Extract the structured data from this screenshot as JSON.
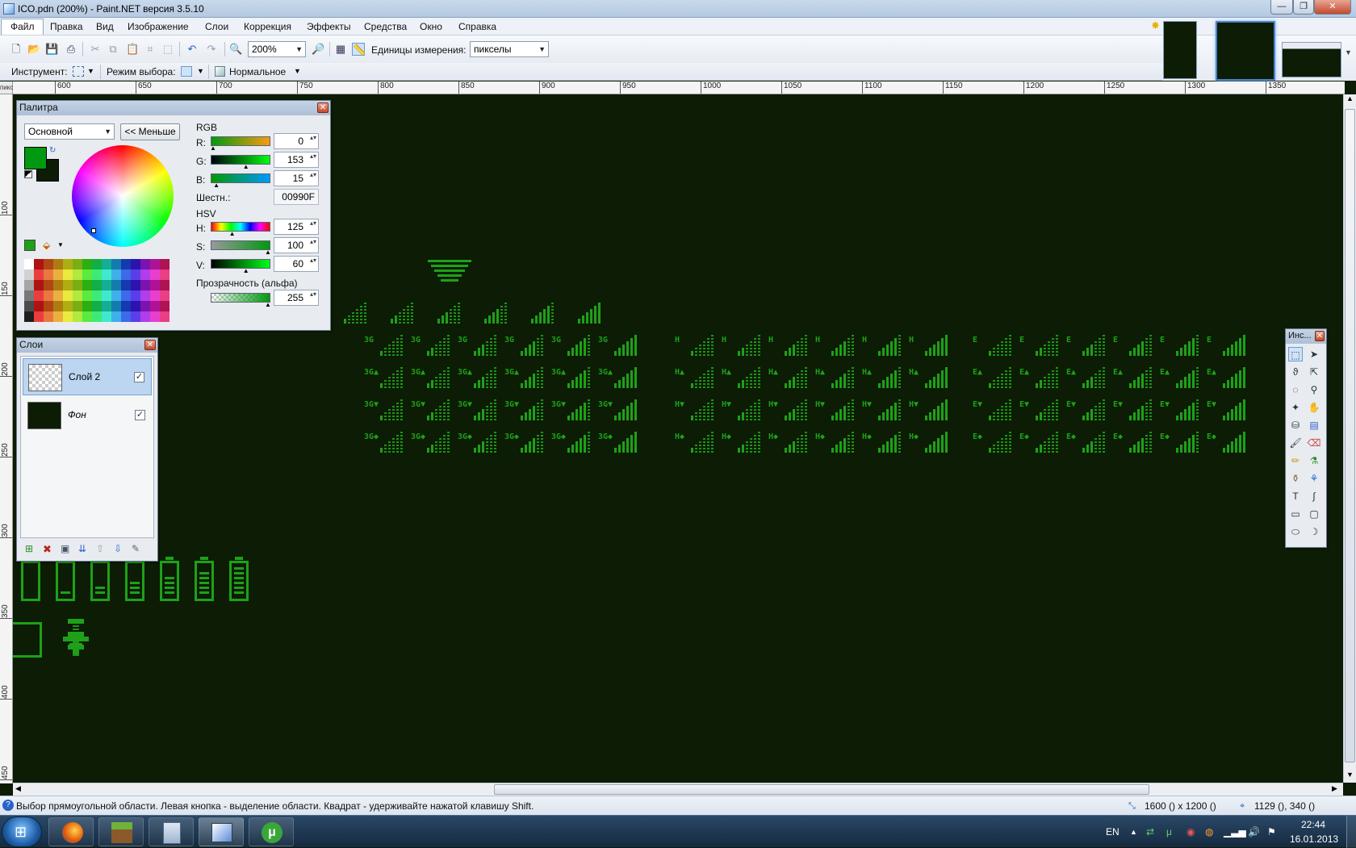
{
  "window": {
    "title": "ICO.pdn (200%) - Paint.NET версия 3.5.10",
    "min": "—",
    "max": "❐",
    "close": "✕"
  },
  "menu": [
    "Файл",
    "Правка",
    "Вид",
    "Изображение",
    "Слои",
    "Коррекция",
    "Эффекты",
    "Средства",
    "Окно",
    "Справка"
  ],
  "toolbar": {
    "zoom": "200%",
    "units_label": "Единицы измерения:",
    "units_value": "пикселы"
  },
  "toolbar2": {
    "tool_label": "Инструмент:",
    "select_mode_label": "Режим выбора:",
    "blend_mode": "Нормальное"
  },
  "ruler": {
    "corner": "пикс",
    "top": [
      "600",
      "650",
      "700",
      "750",
      "800",
      "850",
      "900",
      "950",
      "1000",
      "1050",
      "1100",
      "1150",
      "1200",
      "1250",
      "1300",
      "1350"
    ],
    "left": [
      "100",
      "150",
      "200",
      "250",
      "300",
      "350",
      "400",
      "450"
    ]
  },
  "palette": {
    "title": "Палитра",
    "mode": "Основной",
    "less_button": "<< Меньше",
    "rgb_label": "RGB",
    "hsv_label": "HSV",
    "r_label": "R:",
    "g_label": "G:",
    "b_label": "B:",
    "r": "0",
    "g": "153",
    "b": "15",
    "hex_label": "Шестн.:",
    "hex": "00990F",
    "h_label": "H:",
    "s_label": "S:",
    "v_label": "V:",
    "h": "125",
    "s": "100",
    "v": "60",
    "alpha_label": "Прозрачность (альфа)",
    "alpha": "255",
    "primary_color": "#00990f",
    "secondary_color": "#0c1c05",
    "slider_fill": {
      "r": 0,
      "g": 0.6,
      "b": 0.06,
      "h": 0.347,
      "s": 1.0,
      "v": 0.6,
      "alpha": 1.0
    }
  },
  "layers": {
    "title": "Слои",
    "items": [
      {
        "name": "Слой 2",
        "checked": "✓"
      },
      {
        "name": "Фон",
        "checked": "✓"
      }
    ]
  },
  "tools_panel": {
    "title": "Инс..."
  },
  "status": {
    "hint": "Выбор прямоугольной области. Левая кнопка - выделение области. Квадрат - удерживайте нажатой клавишу Shift.",
    "size": "1600 () x 1200 ()",
    "pos": "1129 (), 340 ()"
  },
  "canvas": {
    "background": "#0c1c05",
    "icon_color": "#1ea118",
    "group_3g_label": "3G",
    "group_h_label": "H",
    "group_e_label": "E",
    "signal_levels": 6,
    "row_suffixes": [
      "",
      "▲",
      "▼",
      "◆"
    ]
  },
  "taskbar": {
    "lang": "EN",
    "time": "22:44",
    "date": "16.01.2013"
  }
}
